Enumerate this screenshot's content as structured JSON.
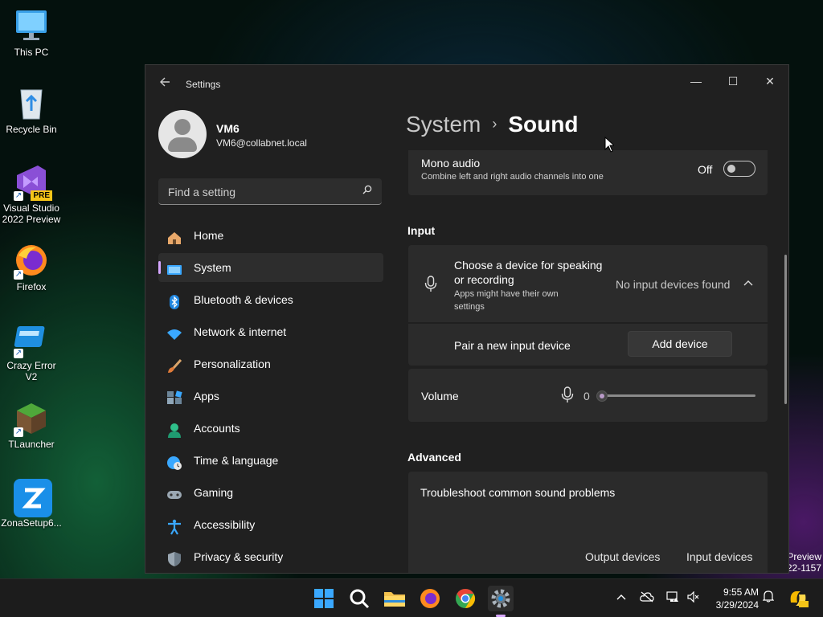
{
  "desktop": {
    "icons": [
      {
        "label": "This PC"
      },
      {
        "label": "Recycle Bin"
      },
      {
        "label": "Visual Studio 2022 Preview",
        "badge": "PRE"
      },
      {
        "label": "Firefox"
      },
      {
        "label": "Crazy Error V2"
      },
      {
        "label": "TLauncher"
      },
      {
        "label": "ZonaSetup6..."
      }
    ],
    "watermark_line1": "Preview",
    "watermark_line2": "22-1157"
  },
  "window": {
    "title": "Settings",
    "controls": {
      "minimize": "—",
      "maximize": "☐",
      "close": "✕"
    }
  },
  "profile": {
    "name": "VM6",
    "email": "VM6@collabnet.local"
  },
  "search": {
    "placeholder": "Find a setting"
  },
  "nav": {
    "items": [
      {
        "label": "Home",
        "icon": "home-icon"
      },
      {
        "label": "System",
        "icon": "system-icon",
        "active": true
      },
      {
        "label": "Bluetooth & devices",
        "icon": "bluetooth-icon"
      },
      {
        "label": "Network & internet",
        "icon": "wifi-icon"
      },
      {
        "label": "Personalization",
        "icon": "brush-icon"
      },
      {
        "label": "Apps",
        "icon": "apps-icon"
      },
      {
        "label": "Accounts",
        "icon": "account-icon"
      },
      {
        "label": "Time & language",
        "icon": "clock-globe-icon"
      },
      {
        "label": "Gaming",
        "icon": "gamepad-icon"
      },
      {
        "label": "Accessibility",
        "icon": "accessibility-icon"
      },
      {
        "label": "Privacy & security",
        "icon": "shield-icon"
      }
    ]
  },
  "breadcrumb": {
    "parent": "System",
    "separator": "›",
    "current": "Sound"
  },
  "mono_audio": {
    "title": "Mono audio",
    "description": "Combine left and right audio channels into one",
    "state_label": "Off"
  },
  "input": {
    "heading": "Input",
    "choose_title": "Choose a device for speaking or recording",
    "choose_description": "Apps might have their own settings",
    "status": "No input devices found",
    "pair_label": "Pair a new input device",
    "add_button": "Add device",
    "volume_label": "Volume",
    "volume_value": "0"
  },
  "advanced": {
    "heading": "Advanced",
    "troubleshoot_title": "Troubleshoot common sound problems",
    "output_link": "Output devices",
    "input_link": "Input devices"
  },
  "taskbar": {
    "time": "9:55 AM",
    "date": "3/29/2024",
    "tray_chevron": "^"
  },
  "colors": {
    "accent": "#d6a6ff",
    "window_bg": "#202020",
    "card_bg": "#2b2b2b"
  }
}
